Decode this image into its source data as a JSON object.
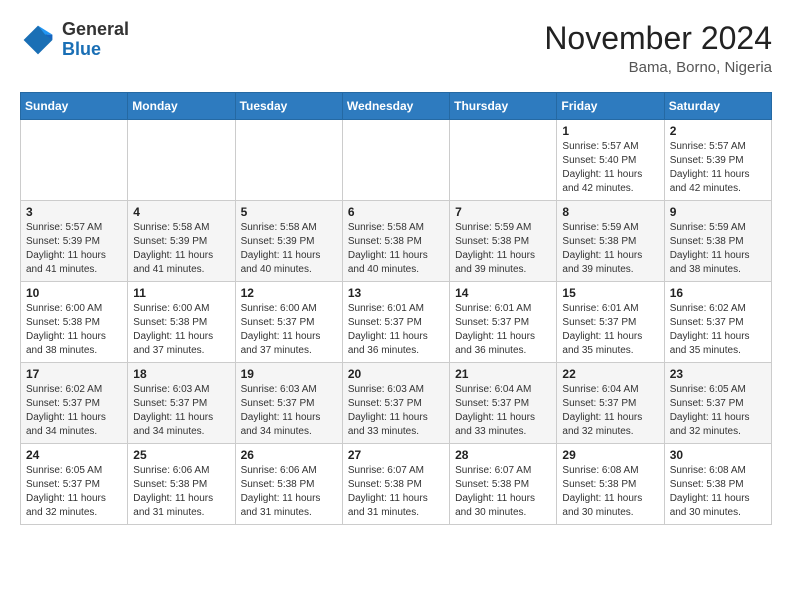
{
  "logo": {
    "general": "General",
    "blue": "Blue"
  },
  "title": "November 2024",
  "location": "Bama, Borno, Nigeria",
  "weekdays": [
    "Sunday",
    "Monday",
    "Tuesday",
    "Wednesday",
    "Thursday",
    "Friday",
    "Saturday"
  ],
  "weeks": [
    [
      {
        "day": "",
        "info": ""
      },
      {
        "day": "",
        "info": ""
      },
      {
        "day": "",
        "info": ""
      },
      {
        "day": "",
        "info": ""
      },
      {
        "day": "",
        "info": ""
      },
      {
        "day": "1",
        "info": "Sunrise: 5:57 AM\nSunset: 5:40 PM\nDaylight: 11 hours\nand 42 minutes."
      },
      {
        "day": "2",
        "info": "Sunrise: 5:57 AM\nSunset: 5:39 PM\nDaylight: 11 hours\nand 42 minutes."
      }
    ],
    [
      {
        "day": "3",
        "info": "Sunrise: 5:57 AM\nSunset: 5:39 PM\nDaylight: 11 hours\nand 41 minutes."
      },
      {
        "day": "4",
        "info": "Sunrise: 5:58 AM\nSunset: 5:39 PM\nDaylight: 11 hours\nand 41 minutes."
      },
      {
        "day": "5",
        "info": "Sunrise: 5:58 AM\nSunset: 5:39 PM\nDaylight: 11 hours\nand 40 minutes."
      },
      {
        "day": "6",
        "info": "Sunrise: 5:58 AM\nSunset: 5:38 PM\nDaylight: 11 hours\nand 40 minutes."
      },
      {
        "day": "7",
        "info": "Sunrise: 5:59 AM\nSunset: 5:38 PM\nDaylight: 11 hours\nand 39 minutes."
      },
      {
        "day": "8",
        "info": "Sunrise: 5:59 AM\nSunset: 5:38 PM\nDaylight: 11 hours\nand 39 minutes."
      },
      {
        "day": "9",
        "info": "Sunrise: 5:59 AM\nSunset: 5:38 PM\nDaylight: 11 hours\nand 38 minutes."
      }
    ],
    [
      {
        "day": "10",
        "info": "Sunrise: 6:00 AM\nSunset: 5:38 PM\nDaylight: 11 hours\nand 38 minutes."
      },
      {
        "day": "11",
        "info": "Sunrise: 6:00 AM\nSunset: 5:38 PM\nDaylight: 11 hours\nand 37 minutes."
      },
      {
        "day": "12",
        "info": "Sunrise: 6:00 AM\nSunset: 5:37 PM\nDaylight: 11 hours\nand 37 minutes."
      },
      {
        "day": "13",
        "info": "Sunrise: 6:01 AM\nSunset: 5:37 PM\nDaylight: 11 hours\nand 36 minutes."
      },
      {
        "day": "14",
        "info": "Sunrise: 6:01 AM\nSunset: 5:37 PM\nDaylight: 11 hours\nand 36 minutes."
      },
      {
        "day": "15",
        "info": "Sunrise: 6:01 AM\nSunset: 5:37 PM\nDaylight: 11 hours\nand 35 minutes."
      },
      {
        "day": "16",
        "info": "Sunrise: 6:02 AM\nSunset: 5:37 PM\nDaylight: 11 hours\nand 35 minutes."
      }
    ],
    [
      {
        "day": "17",
        "info": "Sunrise: 6:02 AM\nSunset: 5:37 PM\nDaylight: 11 hours\nand 34 minutes."
      },
      {
        "day": "18",
        "info": "Sunrise: 6:03 AM\nSunset: 5:37 PM\nDaylight: 11 hours\nand 34 minutes."
      },
      {
        "day": "19",
        "info": "Sunrise: 6:03 AM\nSunset: 5:37 PM\nDaylight: 11 hours\nand 34 minutes."
      },
      {
        "day": "20",
        "info": "Sunrise: 6:03 AM\nSunset: 5:37 PM\nDaylight: 11 hours\nand 33 minutes."
      },
      {
        "day": "21",
        "info": "Sunrise: 6:04 AM\nSunset: 5:37 PM\nDaylight: 11 hours\nand 33 minutes."
      },
      {
        "day": "22",
        "info": "Sunrise: 6:04 AM\nSunset: 5:37 PM\nDaylight: 11 hours\nand 32 minutes."
      },
      {
        "day": "23",
        "info": "Sunrise: 6:05 AM\nSunset: 5:37 PM\nDaylight: 11 hours\nand 32 minutes."
      }
    ],
    [
      {
        "day": "24",
        "info": "Sunrise: 6:05 AM\nSunset: 5:37 PM\nDaylight: 11 hours\nand 32 minutes."
      },
      {
        "day": "25",
        "info": "Sunrise: 6:06 AM\nSunset: 5:38 PM\nDaylight: 11 hours\nand 31 minutes."
      },
      {
        "day": "26",
        "info": "Sunrise: 6:06 AM\nSunset: 5:38 PM\nDaylight: 11 hours\nand 31 minutes."
      },
      {
        "day": "27",
        "info": "Sunrise: 6:07 AM\nSunset: 5:38 PM\nDaylight: 11 hours\nand 31 minutes."
      },
      {
        "day": "28",
        "info": "Sunrise: 6:07 AM\nSunset: 5:38 PM\nDaylight: 11 hours\nand 30 minutes."
      },
      {
        "day": "29",
        "info": "Sunrise: 6:08 AM\nSunset: 5:38 PM\nDaylight: 11 hours\nand 30 minutes."
      },
      {
        "day": "30",
        "info": "Sunrise: 6:08 AM\nSunset: 5:38 PM\nDaylight: 11 hours\nand 30 minutes."
      }
    ]
  ]
}
